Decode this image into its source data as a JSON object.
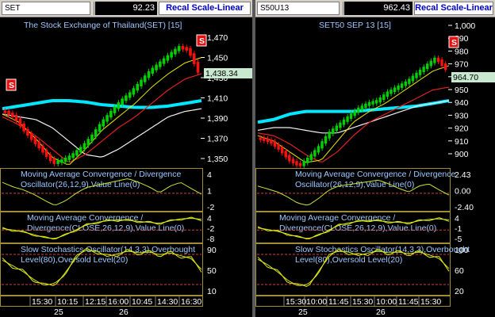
{
  "left": {
    "symbol": "SET",
    "price": "92.23",
    "scale_button": "Recal Scale-Linear",
    "main_title": "The Stock Exchange of Thailand(SET) [15]",
    "last_price_label": "1,438.34",
    "signal_labels": [
      "S",
      "S"
    ],
    "main_axis": [
      "1,470",
      "1,450",
      "1,430",
      "1,410",
      "1,390",
      "1,370",
      "1,350"
    ],
    "osc1_title": [
      "Moving Average Convergence / Divergence",
      "Oscillator(26,12,9),Value Line(0)"
    ],
    "osc1_axis": [
      "4",
      "1",
      "-2"
    ],
    "osc2_title": [
      "Moving Average Convergence /",
      "Divergence(CLOSE,26,12,9),Value Line(0)"
    ],
    "osc2_axis": [
      "4",
      "-2",
      "-8"
    ],
    "osc3_title": [
      "Slow Stochastics Oscillator(14,3,3),Overbought",
      "Level(80),Oversold Level(20)"
    ],
    "osc3_axis": [
      "90",
      "50",
      "10"
    ],
    "time_labels": [
      "15:30",
      "10:15",
      "12:15",
      "16:00",
      "10:45",
      "14:30",
      "16:30"
    ],
    "day_labels": [
      "25",
      "26"
    ]
  },
  "right": {
    "symbol": "S50U13",
    "price": "962.43",
    "scale_button": "Recal Scale-Linear",
    "main_title": "SET50 SEP 13   [15]",
    "last_price_label": "964.70",
    "signal_labels": [
      "S"
    ],
    "main_axis": [
      "1,000",
      "990",
      "980",
      "970",
      "960",
      "950",
      "940",
      "930",
      "920",
      "910",
      "900"
    ],
    "osc1_title": [
      "Moving Average Convergence / Divergence",
      "Oscillator(26,12,9),Value Line(0)"
    ],
    "osc1_axis": [
      "2.43",
      "0.00",
      "-2.40"
    ],
    "osc2_title": [
      "Moving Average Convergence /",
      "Divergence(CLOSE,26,12,9),Value Line(0)"
    ],
    "osc2_axis": [
      "4",
      "-1",
      "-5"
    ],
    "osc3_title": [
      "Slow Stochastics Oscillator(14,3,3),Overbought",
      "Level(80),Oversold Level(20)"
    ],
    "osc3_axis": [
      "100",
      "60",
      "20"
    ],
    "time_labels": [
      "15:30",
      "10:00",
      "11:45",
      "15:30",
      "10:00",
      "11:45",
      "15:30"
    ],
    "day_labels": [
      "25",
      "26"
    ]
  },
  "colors": {
    "title": "#9cc8ff",
    "axis_text": "#ffffff",
    "price_label_bg": "#c8e8d0",
    "frame": "#a08c32",
    "candle_up": "#00d000",
    "candle_down": "#ff1010",
    "ma_cyan": "#00e8ff",
    "ma_white": "#f0f0f0",
    "ma_red": "#e02020",
    "ma_yellow": "#e8e800",
    "ref_line": "#d04040",
    "osc_line": "#c8e830"
  }
}
